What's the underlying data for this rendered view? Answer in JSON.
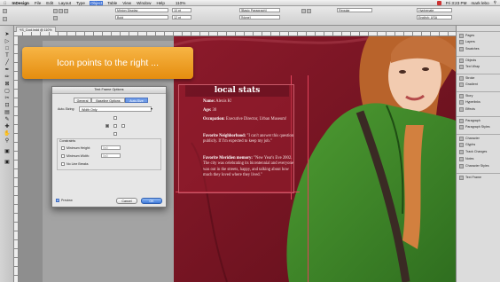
{
  "menubar": {
    "apple": "",
    "app": "InDesign",
    "items": [
      "File",
      "Edit",
      "Layout",
      "Type",
      "Object",
      "Table",
      "View",
      "Window",
      "Help"
    ],
    "active": "Object",
    "clock": "Fri 3:23 PM",
    "user": "mark lebo",
    "workspace": "Typography",
    "zoom": "110%"
  },
  "control": {
    "font_family": "Minion Display",
    "font_style": "Bold",
    "size": "10 pt",
    "leading": "12 pt",
    "paragraph_style": "[Basic Paragraph]",
    "char_style": "[None]",
    "language": "English: USA",
    "hyphenate_label": "Hyphenate",
    "nothing": "Regular"
  },
  "document": {
    "tab_label": "*IS_Cool.indd @ 110%"
  },
  "tip": {
    "text": "Icon points to the right ..."
  },
  "dialog": {
    "title": "Text Frame Options",
    "tabs": [
      "General",
      "Baseline Options",
      "Auto-Size"
    ],
    "selected_tab": "Auto-Size",
    "autosizing_label": "Auto-Sizing:",
    "autosizing_value": "Width Only",
    "constraints_label": "Constraints",
    "min_height_label": "Minimum Height:",
    "min_height_value": "0p0",
    "min_width_label": "Minimum Width:",
    "min_width_value": "0p0",
    "no_line_breaks_label": "No Line Breaks",
    "preview_label": "Preview",
    "preview_checked": true,
    "cancel_label": "Cancel",
    "ok_label": "OK"
  },
  "overlay": {
    "header": "local stats",
    "name_label": "Name:",
    "name_value": "Alexis K!",
    "age_label": "Age:",
    "age_value": "30",
    "occupation_label": "Occupation:",
    "occupation_value": "Executive Director, Urban Museum!",
    "neighborhood_label": "Favorite Neighborhood:",
    "neighborhood_value": "\"I can't answer this question publicly. If I'm expected to keep my job.\"",
    "memory_label": "Favorite Meridien memory:",
    "memory_value": "\"New Year's Eve 2002. The city was celebrating its bicentennial and everyone was out in the streets, happy, and talking about how much they loved where they lived.\""
  },
  "panels": {
    "items": [
      "Pages",
      "Layers",
      "Swatches",
      "Objects",
      "Text Wrap",
      "Stroke",
      "Gradient",
      "Story",
      "Hyperlinks",
      "Effects",
      "Paragraph",
      "Paragraph Styles",
      "Character",
      "Glyphs",
      "Track Changes",
      "Notes",
      "Character Styles",
      "Text Frame"
    ]
  },
  "colors": {
    "accent": "#e58d0f",
    "photo_bg": "#7b1624",
    "jacket": "#3f8a2a",
    "guide": "#e2435b"
  }
}
